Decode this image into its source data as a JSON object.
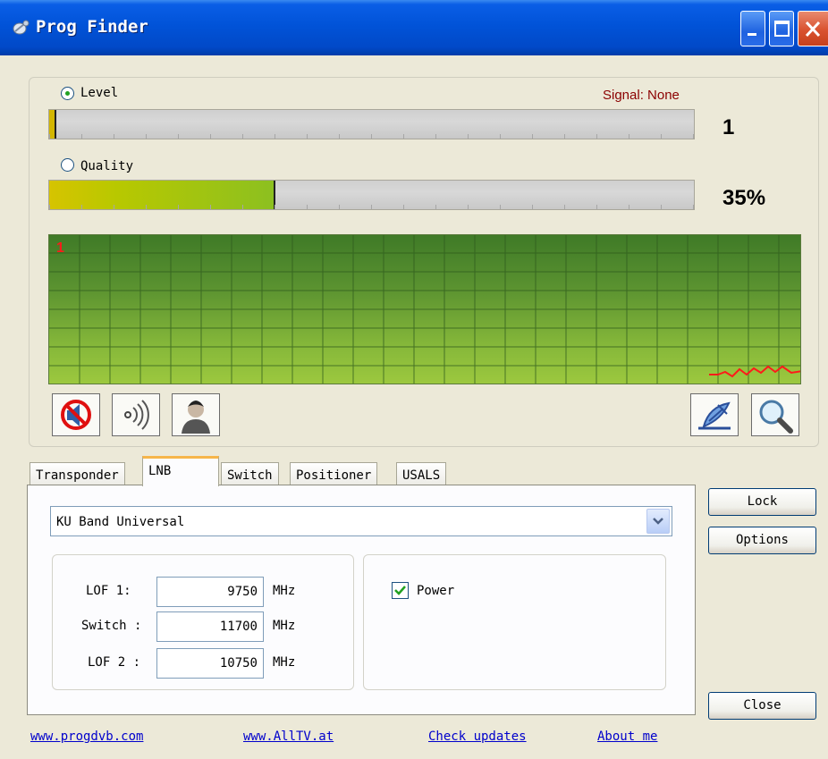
{
  "window": {
    "title": "Prog Finder"
  },
  "signal": {
    "level_label": "Level",
    "level_selected": true,
    "quality_label": "Quality",
    "quality_selected": false,
    "signal_status": "Signal: None",
    "level_value": "1",
    "quality_value": "35%",
    "level_fraction": 0.01,
    "quality_fraction": 0.35,
    "graph_label": "1"
  },
  "toolbar": {
    "icons": [
      "mute-icon",
      "sound-icon",
      "user-icon",
      "satellite-dish-icon",
      "search-icon"
    ]
  },
  "tabs": [
    {
      "label": "Transponder",
      "active": false
    },
    {
      "label": "LNB",
      "active": true
    },
    {
      "label": "Switch",
      "active": false
    },
    {
      "label": "Positioner",
      "active": false
    },
    {
      "label": "USALS",
      "active": false
    }
  ],
  "lnb": {
    "type": "KU Band Universal",
    "lof1_label": "LOF 1:",
    "lof1_value": "9750",
    "switch_label": "Switch :",
    "switch_value": "11700",
    "lof2_label": "LOF 2 :",
    "lof2_value": "10750",
    "unit": "MHz",
    "power_label": "Power",
    "power_checked": true
  },
  "buttons": {
    "lock": "Lock",
    "options": "Options",
    "close": "Close"
  },
  "links": {
    "progdvb": "www.progdvb.com",
    "alltv": "www.AllTV.at",
    "updates": "Check updates",
    "about": "About me"
  },
  "colors": {
    "signal_status": "#8b0000",
    "graph_trace": "#ff1a1a",
    "title_bar": "#0153d8"
  }
}
